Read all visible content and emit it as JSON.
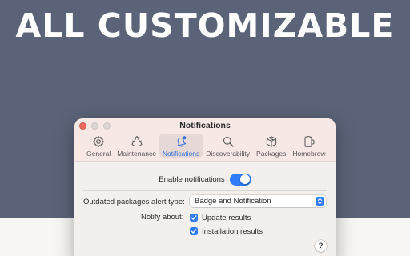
{
  "headline": "ALL CUSTOMIZABLE",
  "window": {
    "title": "Notifications"
  },
  "tabs": [
    {
      "label": "General",
      "icon": "gear-icon"
    },
    {
      "label": "Maintenance",
      "icon": "recycle-icon"
    },
    {
      "label": "Notifications",
      "icon": "bell-icon",
      "active": true
    },
    {
      "label": "Discoverability",
      "icon": "magnifier-icon"
    },
    {
      "label": "Packages",
      "icon": "box-icon"
    },
    {
      "label": "Homebrew",
      "icon": "mug-icon"
    }
  ],
  "settings": {
    "enable_label": "Enable notifications",
    "enable_on": true,
    "alert_type_label": "Outdated packages alert type:",
    "alert_type_value": "Badge and Notification",
    "notify_about_label": "Notify about:",
    "notify_options": [
      {
        "label": "Update results",
        "checked": true
      },
      {
        "label": "Installation results",
        "checked": true
      }
    ],
    "help_label": "?"
  },
  "colors": {
    "background": "#5b6378",
    "accent": "#2f7cf6",
    "window_toolbar": "#f7e8e6",
    "window_body": "#f3efec"
  }
}
